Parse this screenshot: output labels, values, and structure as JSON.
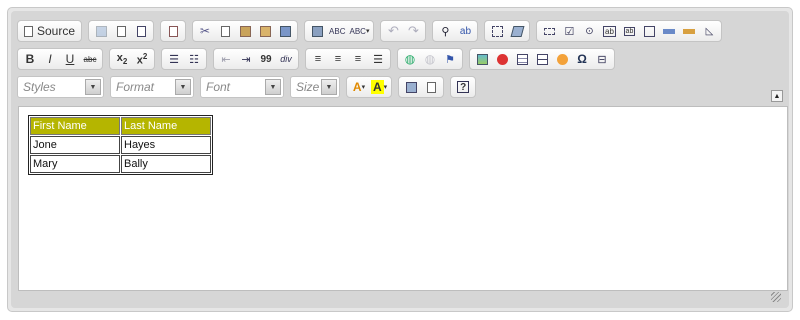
{
  "toolbar": {
    "source_label": "Source",
    "styles_label": "Styles",
    "format_label": "Format",
    "font_label": "Font",
    "size_label": "Size",
    "help_label": "?",
    "spell_label": "ABC",
    "strike_label": "abc",
    "div_label": "div",
    "quote_label": "99"
  },
  "table": {
    "headers": [
      "First Name",
      "Last Name"
    ],
    "rows": [
      [
        "Jone",
        "Hayes"
      ],
      [
        "Mary",
        "Bally"
      ]
    ]
  },
  "colors": {
    "header_bg": "#b5b500",
    "toolbar_bg": "#d6d6d6"
  }
}
